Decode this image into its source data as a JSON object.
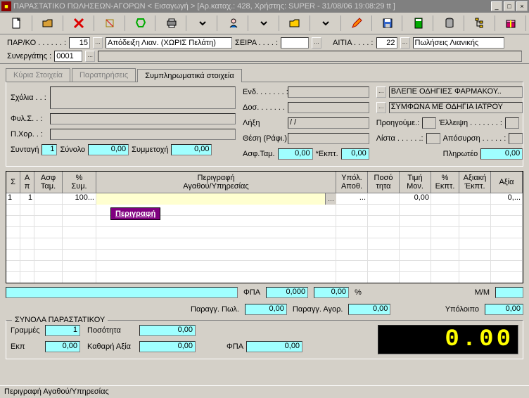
{
  "window": {
    "title": "ΠΑΡΑΣΤΑΤΙΚΟ ΠΩΛΗΣΕΩΝ-ΑΓΟΡΩΝ < Εισαγωγή > [Αρ.καταχ.: 428, Χρήστης: SUPER - 31/08/06 19:08:29 tt ]"
  },
  "hdr": {
    "parko_lbl": "ΠΑΡ/ΚΟ . . . . . . :",
    "parko_v": "15",
    "parko_desc": "Απόδειξη Λιαν. (ΧΩΡΙΣ Πελάτη)",
    "seira_lbl": "ΣΕΙΡΑ . . . . :",
    "seira_v": "",
    "aitia_lbl": "ΑΙΤΙΑ . . . . :",
    "aitia_v": "22",
    "aitia_desc": "Πωλήσεις Λιανικής",
    "syn_lbl": "Συνεργάτης :",
    "syn_v": "0001"
  },
  "tabs": {
    "t1": "Κύρια Στοιχεία",
    "t2": "Παρατηρήσεις",
    "t3": "Συμπληρωματικά στοιχεία"
  },
  "panel": {
    "sxolia_lbl": "Σχόλια . . :",
    "fyls_lbl": "Φυλ.Σ. . :",
    "pxor_lbl": "Π.Χορ. . :",
    "syntagi_lbl": "Συνταγή",
    "syntagi_v": "1",
    "synolo_lbl": "Σύνολο",
    "synolo_v": "0,00",
    "symm_lbl": "Συμμετοχή",
    "symm_v": "0,00",
    "end_lbl": "Ενδ. . . . . . . :",
    "dos_lbl": "Δοσ. . . . . . . :",
    "lixh_lbl": "Λήξη",
    "lixh_v": "  /  /",
    "thesi_lbl": "Θέση (Ράφι.):",
    "asftam_lbl": "Ασφ.Ταμ.",
    "asftam_v": "0,00",
    "ekpt_lbl": "*Εκπτ.",
    "ekpt_v": "0,00",
    "end_desc": "ΒΛΕΠΕ ΟΔΗΓΙΕΣ ΦΑΡΜΑΚΟΥ..",
    "dos_desc": "ΣΥΜΦΩΝΑ ΜΕ ΟΔΗΓΙΑ ΙΑΤΡΟΥ",
    "proi_lbl": "Προηγούμε.:",
    "lista_lbl": "Λίστα . . . . . .:",
    "ell_lbl": "Έλλειψη . . . . . . . :",
    "apos_lbl": "Απόσυρση . . . . . :",
    "plir_lbl": "Πληρωτέο",
    "plir_v": "0,00"
  },
  "grid": {
    "h_s": "Σ",
    "h_ap": "Α\nπ",
    "h_asftam": "Ασφ\nΤαμ.",
    "h_sym": "%\nΣυμ.",
    "h_desc": "Περιγραφή\nΑγαθού/Υπηρεσίας",
    "h_ypol": "Υπόλ.\nΑποθ.",
    "h_poso": "Ποσό\nτητα",
    "h_timi": "Τιμή\nΜον.",
    "h_ekpt": "%\nΕκπτ.",
    "h_axekpt": "Αξιακή\nΈκπτ.",
    "h_axia": "Αξία",
    "r1_s": "1",
    "r1_ap": "1",
    "r1_sym": "100...",
    "r1_ypol": "...",
    "r1_timi": "0,00",
    "r1_axia": "0,...",
    "tooltip": "Περιγραφή"
  },
  "sum": {
    "fpa_lbl": "ΦΠΑ",
    "fpa_v": "0,000",
    "fpa_pct_v": "0,00",
    "fpa_pct_sym": "%",
    "pargpol_lbl": "Παραγγ. Πωλ.",
    "pargpol_v": "0,00",
    "pargagr_lbl": "Παραγγ. Αγορ.",
    "pargagr_v": "0,00",
    "mm_lbl": "Μ/Μ",
    "ypol_lbl": "Υπόλοιπο",
    "ypol_v": "0,00"
  },
  "totals": {
    "title": "ΣΥΝΟΛΑ ΠΑΡΑΣΤΑΤΙΚΟΥ",
    "grammes_lbl": "Γραμμές",
    "grammes_v": "1",
    "posot_lbl": "Ποσότητα",
    "posot_v": "0,00",
    "ekp_lbl": "Εκπ",
    "ekp_v": "0,00",
    "kath_lbl": "Καθαρή Αξία",
    "kath_v": "0,00",
    "fpa_lbl": "ΦΠΑ",
    "fpa_v": "0,00",
    "led": "0.00"
  },
  "status": "Περιγραφή Αγαθού/Υπηρεσίας"
}
